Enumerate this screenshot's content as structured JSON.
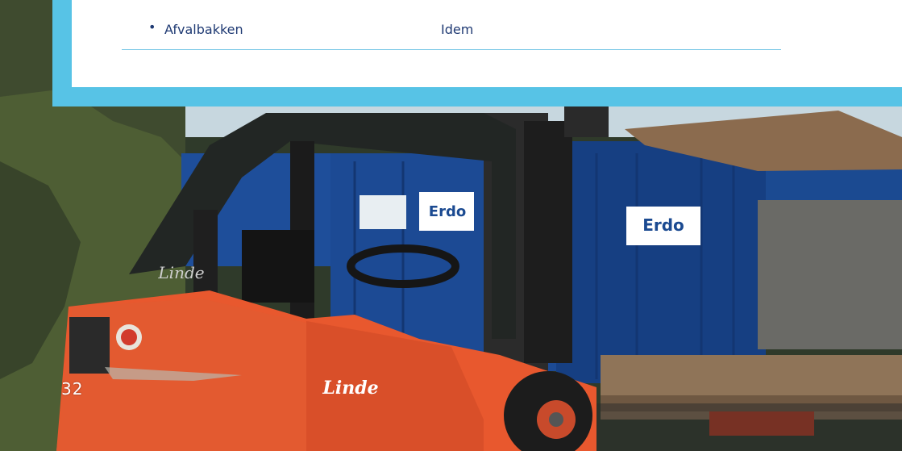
{
  "table_row": {
    "bullet": "•",
    "item": "Afvalbakken",
    "value": "Idem"
  },
  "page_number": "32",
  "brand": {
    "forklift": "Linde",
    "container": "Erdo"
  },
  "colors": {
    "card_border": "#57c3e6",
    "text": "#1f3a73",
    "divider": "#79c8e6"
  }
}
